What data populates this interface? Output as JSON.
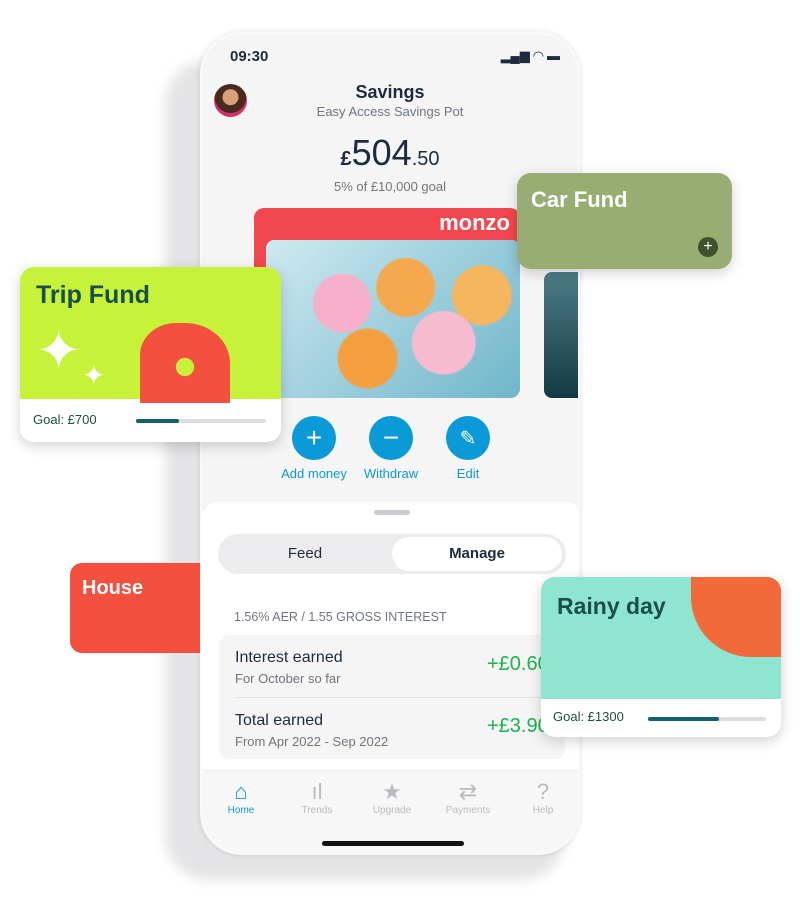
{
  "status": {
    "time": "09:30"
  },
  "header": {
    "title": "Savings",
    "subtitle": "Easy Access Savings Pot"
  },
  "balance": {
    "currency": "£",
    "whole": "504",
    "pence": ".50",
    "goal_text": "5% of £10,000 goal"
  },
  "card": {
    "brand": "monzo"
  },
  "actions": [
    {
      "label": "Add money",
      "icon": "plus-icon"
    },
    {
      "label": "Withdraw",
      "icon": "minus-icon"
    },
    {
      "label": "Edit",
      "icon": "pencil-icon"
    }
  ],
  "tabs": {
    "feed": "Feed",
    "manage": "Manage",
    "active": "Manage"
  },
  "interest": {
    "rate": "1.56% AER / 1.55 GROSS INTEREST",
    "rows": [
      {
        "title": "Interest earned",
        "sub": "For October so far",
        "value": "+£0.60"
      },
      {
        "title": "Total earned",
        "sub": "From Apr 2022 - Sep 2022",
        "value": "+£3.90"
      }
    ]
  },
  "nav": [
    {
      "label": "Home",
      "active": true
    },
    {
      "label": "Trends"
    },
    {
      "label": "Upgrade"
    },
    {
      "label": "Payments"
    },
    {
      "label": "Help"
    }
  ],
  "pots": {
    "trip": {
      "name": "Trip Fund",
      "goal": "Goal: £700",
      "progress": 0.33,
      "color": "#c6f23a"
    },
    "car": {
      "name": "Car Fund",
      "color": "#97ad72"
    },
    "house": {
      "name": "House",
      "color": "#f4503f"
    },
    "rainy": {
      "name": "Rainy day",
      "goal": "Goal: £1300",
      "progress": 0.6,
      "color": "#8ee5d0"
    }
  },
  "colors": {
    "accent": "#0a9ad8",
    "positive": "#1ab34e",
    "monzo_red": "#f3474f"
  }
}
